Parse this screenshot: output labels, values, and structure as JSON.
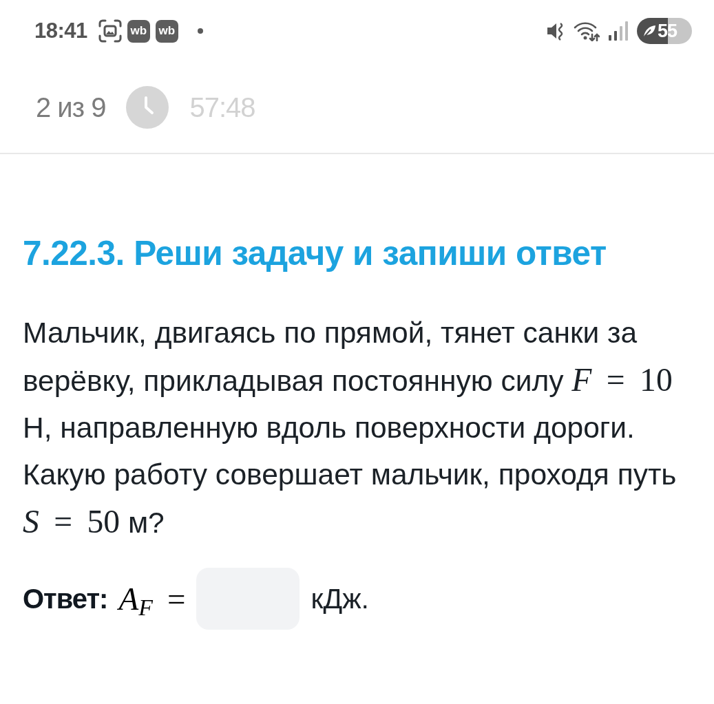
{
  "status_bar": {
    "time": "18:41",
    "notifications": [
      {
        "kind": "screenshot"
      },
      {
        "kind": "app",
        "label": "wb"
      },
      {
        "kind": "app",
        "label": "wb"
      },
      {
        "kind": "dot"
      }
    ],
    "battery": "55"
  },
  "header": {
    "counter": "2 из 9",
    "timer": "57:48"
  },
  "task": {
    "title": "7.22.3. Реши задачу и запиши ответ",
    "text": [
      {
        "kind": "text",
        "text": "Мальчик, двигаясь по прямой, тянет санки за верёвку, прикладывая постоянную силу "
      },
      {
        "kind": "math",
        "text": "*F* = 10"
      },
      {
        "kind": "text",
        "text": " Н, направленную вдоль поверхности дороги. Какую работу совершает мальчик, проходя путь "
      },
      {
        "kind": "math",
        "text": "*S* = 50"
      },
      {
        "kind": "text",
        "text": " м?"
      }
    ]
  },
  "answer": {
    "label": "Ответ:",
    "math": "*A*$_{F}$ =",
    "unit": "кДж."
  }
}
